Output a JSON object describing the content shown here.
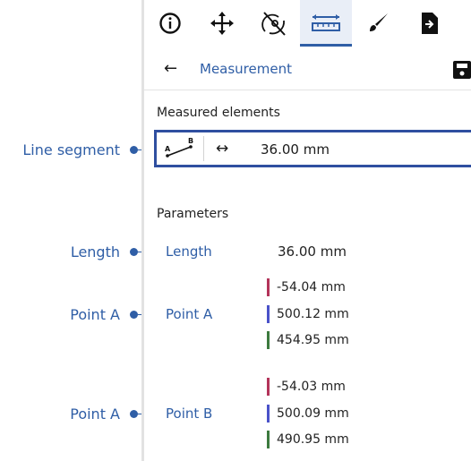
{
  "callouts": {
    "line_segment": "Line segment",
    "length": "Length",
    "point_a_1": "Point A",
    "point_a_2": "Point A"
  },
  "toolbar": {
    "active_tool": "measurement-tool",
    "tools": [
      "info-icon",
      "move-icon",
      "hide-icon",
      "ruler-icon",
      "brush-icon",
      "export-icon"
    ]
  },
  "nav": {
    "back_glyph": "←",
    "title": "Measurement"
  },
  "measured": {
    "heading": "Measured elements",
    "icon_label_a": "A",
    "icon_label_b": "B",
    "arrow_glyph": "↔",
    "value": "36.00 mm"
  },
  "parameters": {
    "heading": "Parameters",
    "length": {
      "label": "Length",
      "value": "36.00 mm"
    },
    "point_a": {
      "label": "Point A",
      "x": "-54.04 mm",
      "y": "500.12 mm",
      "z": "454.95 mm"
    },
    "point_b": {
      "label": "Point B",
      "x": "-54.03 mm",
      "y": "500.09 mm",
      "z": "490.95 mm"
    }
  },
  "colors": {
    "accent": "#2f5ea6",
    "axis_x": "#b3345a",
    "axis_y": "#4a52c9",
    "axis_z": "#3c7a3e"
  }
}
